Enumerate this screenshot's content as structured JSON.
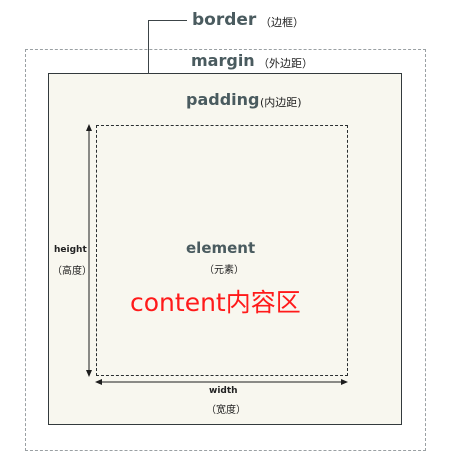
{
  "labels": {
    "border": "border",
    "border_cn": "（边框）",
    "margin": "margin",
    "margin_cn": "（外边距）",
    "padding": "padding",
    "padding_cn": "(内边距)",
    "element": "element",
    "element_cn": "（元素）",
    "content": "content内容区",
    "height": "height",
    "height_cn": "（高度）",
    "width": "width",
    "width_cn": "（宽度）"
  },
  "colors": {
    "label_text": "#4a5b5f",
    "content_text": "#ff1a1a",
    "border_fill": "#f8f7ef",
    "border_line": "#333a3d",
    "margin_line": "#9aa0a3"
  }
}
